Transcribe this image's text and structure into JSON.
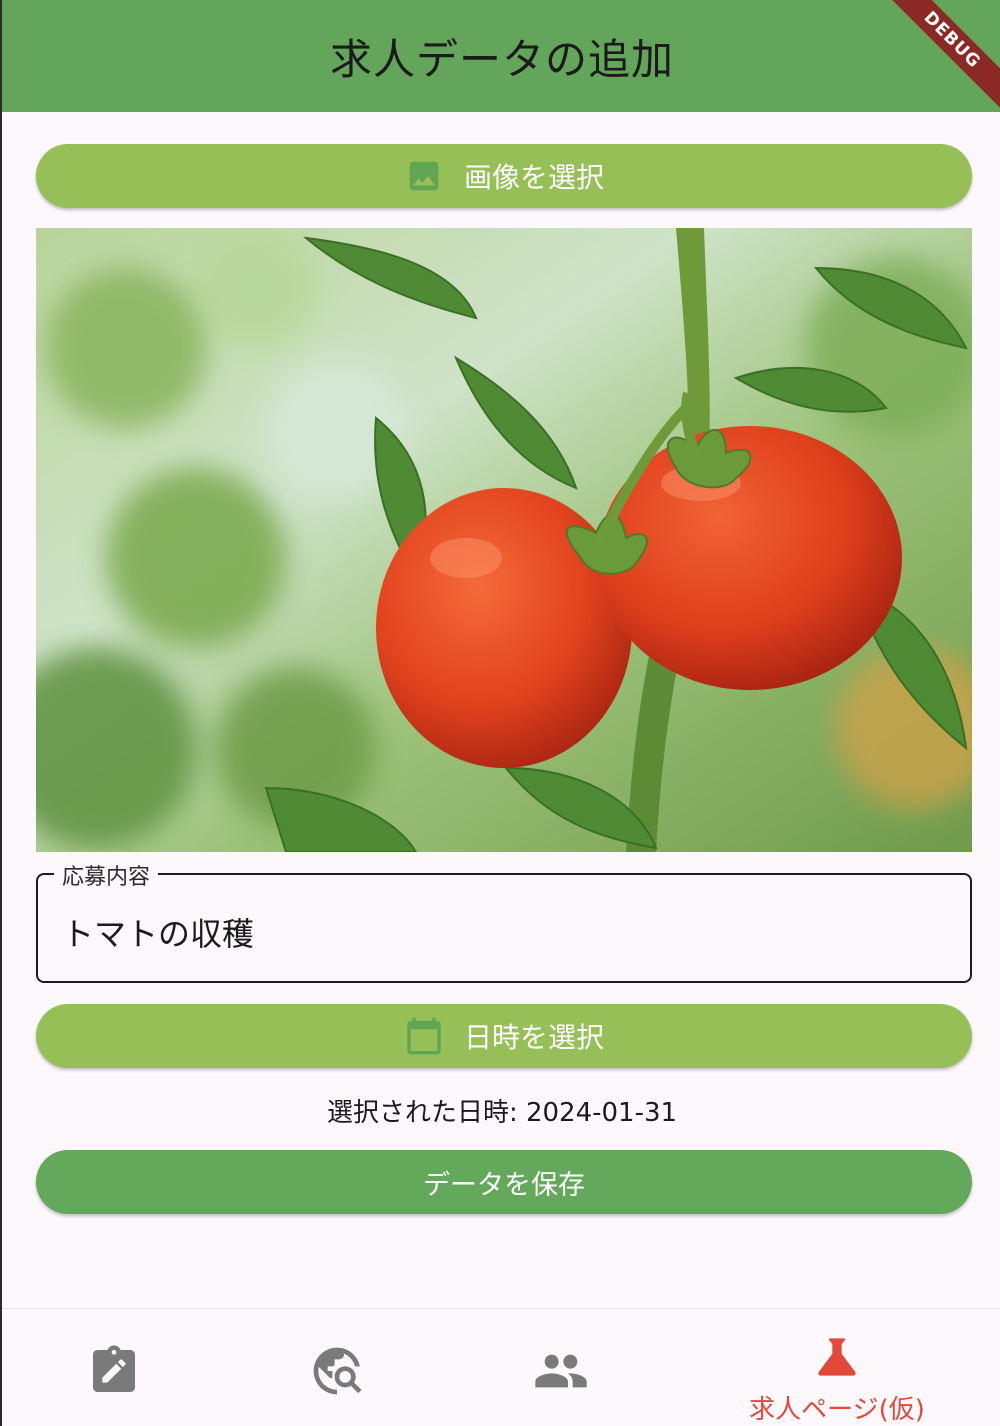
{
  "appbar": {
    "title": "求人データの追加",
    "debug_banner": "DEBUG",
    "color": "#63a55a"
  },
  "image_button": {
    "label": "画像を選択",
    "icon": "image-icon"
  },
  "photo": {
    "subject": "tomato-photo"
  },
  "application_field": {
    "label": "応募内容",
    "value": "トマトの収穫"
  },
  "date_button": {
    "label": "日時を選択",
    "icon": "calendar-icon"
  },
  "selected_date_text": "選択された日時: 2024-01-31",
  "save_button": {
    "label": "データを保存"
  },
  "bottom_nav": {
    "items": [
      {
        "icon": "assignment-edit-icon",
        "label": "",
        "active": false
      },
      {
        "icon": "travel-explore-icon",
        "label": "",
        "active": false
      },
      {
        "icon": "people-icon",
        "label": "",
        "active": false
      },
      {
        "icon": "flask-icon",
        "label": "求人ページ(仮)",
        "active": true
      }
    ],
    "active_color": "#e2493a",
    "inactive_color": "#7a7a7a"
  },
  "colors": {
    "button_light_green": "#97bf58",
    "button_green": "#64a85c",
    "background": "#fdf8fc"
  }
}
